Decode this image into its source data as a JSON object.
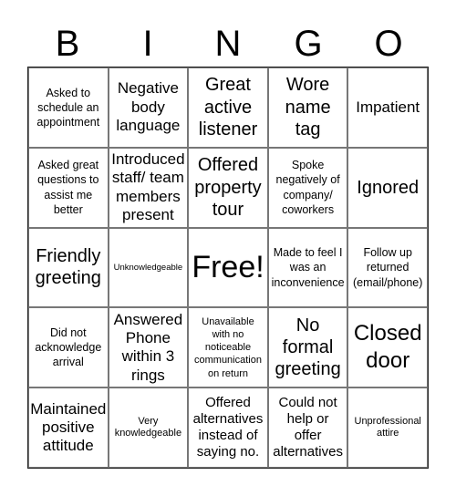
{
  "header": {
    "letters": [
      "B",
      "I",
      "N",
      "G",
      "O"
    ]
  },
  "cells": [
    [
      "Asked to schedule an appointment",
      "Negative body language",
      "Great active listener",
      "Wore name tag",
      "Impatient"
    ],
    [
      "Asked great questions to assist me better",
      "Introduced staff/ team members present",
      "Offered property tour",
      "Spoke negatively of company/ coworkers",
      "Ignored"
    ],
    [
      "Friendly greeting",
      "Unknowledgeable",
      "Free!",
      "Made to feel I was an inconvenience",
      "Follow up returned (email/phone)"
    ],
    [
      "Did not acknowledge arrival",
      "Answered Phone within 3 rings",
      "Unavailable with no noticeable communication on return",
      "No formal greeting",
      "Closed door"
    ],
    [
      "Maintained positive attitude",
      "Very knowledgeable",
      "Offered alternatives instead of saying no.",
      "Could not help or offer alternatives",
      "Unprofessional attire"
    ]
  ]
}
